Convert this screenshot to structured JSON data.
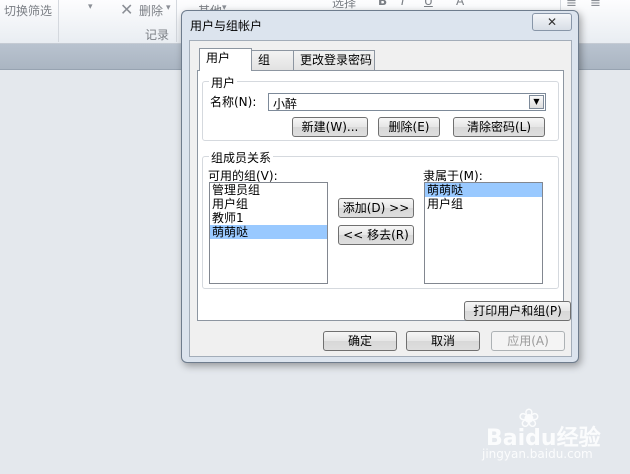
{
  "ribbon": {
    "filter_toggle": "切换筛选",
    "delete": "删除",
    "delete_arrow": "▾",
    "records_group": "记录",
    "other": "其他",
    "other_arrow": "▾",
    "select": "选择",
    "font_bold": "B",
    "font_italic": "I",
    "font_underline": "U",
    "font_color": "A"
  },
  "dialog": {
    "title": "用户与组帐户",
    "close_glyph": "✕",
    "tabs": [
      {
        "label": "用户"
      },
      {
        "label": "组"
      },
      {
        "label": "更改登录密码"
      }
    ],
    "user_group": {
      "title": "用户",
      "name_label": "名称(N):",
      "name_value": "小醉",
      "new_button": "新建(W)...",
      "delete_button": "删除(E)",
      "clear_password_button": "清除密码(L)"
    },
    "membership": {
      "title": "组成员关系",
      "available_label": "可用的组(V):",
      "available_items": [
        "管理员组",
        "用户组",
        "教师1",
        "萌萌哒"
      ],
      "available_selected": 3,
      "member_of_label": "隶属于(M):",
      "member_of_items": [
        "萌萌哒",
        "用户组"
      ],
      "member_of_selected": 0,
      "add_button": "添加(D) >>",
      "remove_button": "<< 移去(R)"
    },
    "print_button": "打印用户和组(P)",
    "ok_button": "确定",
    "cancel_button": "取消",
    "apply_button": "应用(A)"
  },
  "watermark": {
    "logo": "Baidu经验",
    "url": "jingyan.baidu.com"
  }
}
